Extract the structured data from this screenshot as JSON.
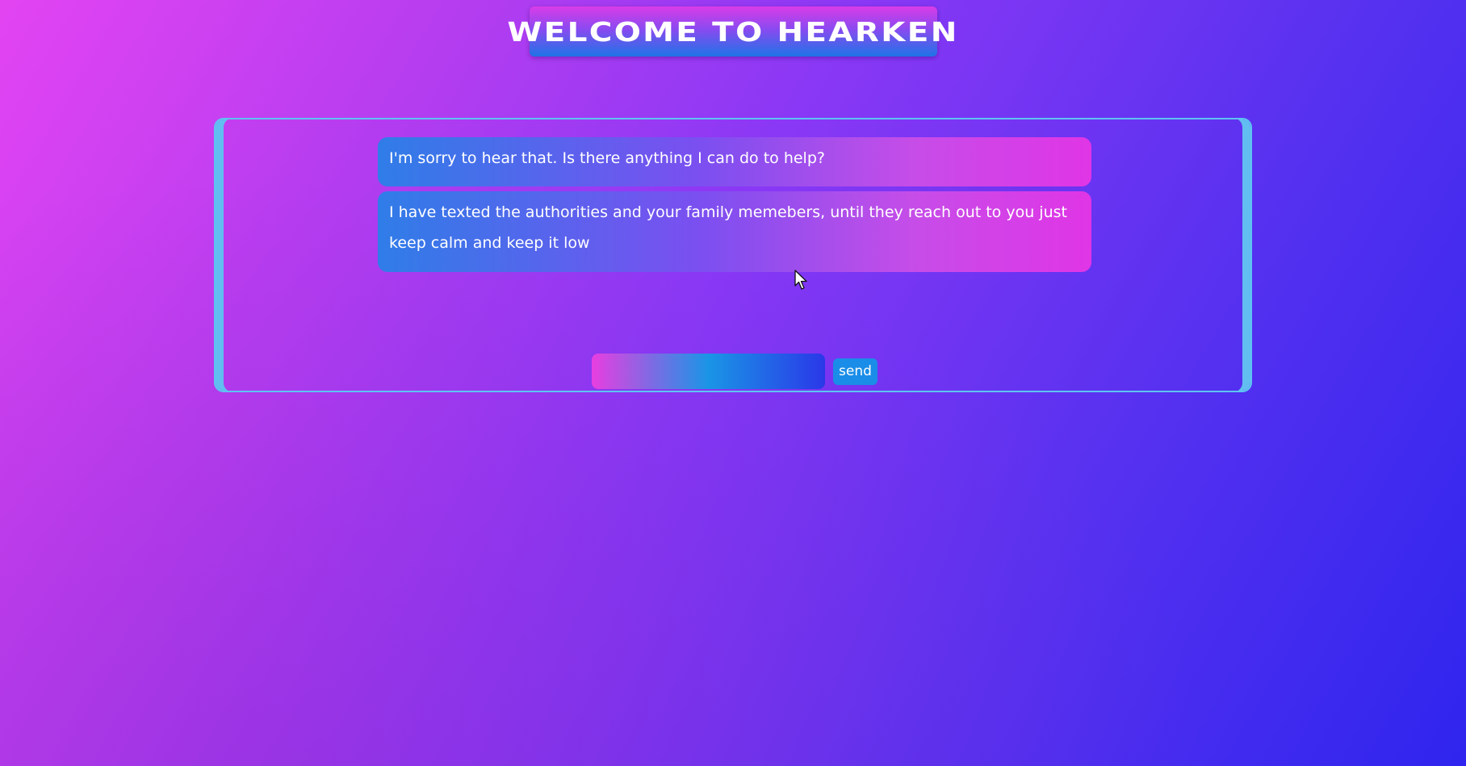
{
  "header": {
    "title": "WELCOME TO HEARKEN"
  },
  "chat": {
    "messages": [
      {
        "text": "I'm sorry to hear that. Is there anything I can do to help?"
      },
      {
        "text": "I have texted the authorities and your family memebers, until they reach out to you just keep calm and keep it low"
      }
    ],
    "input": {
      "value": "",
      "placeholder": ""
    },
    "send_label": "send"
  },
  "colors": {
    "background_start": "#e344f2",
    "background_end": "#2f25ee",
    "panel_border": "#5ec3f2",
    "send_button": "#1a8de8"
  },
  "icons": {
    "cursor": "mouse-pointer-icon"
  }
}
